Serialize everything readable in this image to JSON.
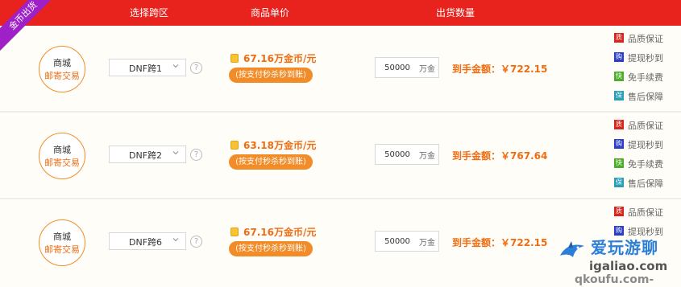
{
  "ribbon": "金币出货",
  "header": {
    "col_server": "选择跨区",
    "col_price": "商品单价",
    "col_qty": "出货数量"
  },
  "colors": {
    "header_bg": "#e8231d",
    "accent_orange": "#ee6d12",
    "ribbon_purple": "#a020c8",
    "guarantee_icons": [
      "#d9261c",
      "#2b3fc6",
      "#4cae2a",
      "#2a9fb8"
    ]
  },
  "rows": [
    {
      "circle_line1": "商城",
      "circle_line2": "邮寄交易",
      "server": "DNF跨1",
      "help": "?",
      "price": "67.16万金币/元",
      "badge": "(按支付秒杀秒到账)",
      "qty_value": "50000",
      "qty_unit": "万金",
      "amount": "到手金额：￥722.15",
      "guarantees": [
        {
          "icon": "质",
          "label": "品质保证"
        },
        {
          "icon": "购",
          "label": "提现秒到"
        },
        {
          "icon": "快",
          "label": "免手续费"
        },
        {
          "icon": "保",
          "label": "售后保障"
        }
      ]
    },
    {
      "circle_line1": "商城",
      "circle_line2": "邮寄交易",
      "server": "DNF跨2",
      "help": "?",
      "price": "63.18万金币/元",
      "badge": "(按支付秒杀秒到账)",
      "qty_value": "50000",
      "qty_unit": "万金",
      "amount": "到手金额：￥767.64",
      "guarantees": [
        {
          "icon": "质",
          "label": "品质保证"
        },
        {
          "icon": "购",
          "label": "提现秒到"
        },
        {
          "icon": "快",
          "label": "免手续费"
        },
        {
          "icon": "保",
          "label": "售后保障"
        }
      ]
    },
    {
      "circle_line1": "商城",
      "circle_line2": "邮寄交易",
      "server": "DNF跨6",
      "help": "?",
      "price": "67.16万金币/元",
      "badge": "(按支付秒杀秒到账)",
      "qty_value": "50000",
      "qty_unit": "万金",
      "amount": "到手金额：￥722.15",
      "guarantees": [
        {
          "icon": "质",
          "label": "品质保证"
        },
        {
          "icon": "购",
          "label": "提现秒到"
        }
      ]
    }
  ],
  "watermark": {
    "line1": "爱玩游聊",
    "line2": "igaliao.com",
    "line3": "qkoufu.com-"
  }
}
